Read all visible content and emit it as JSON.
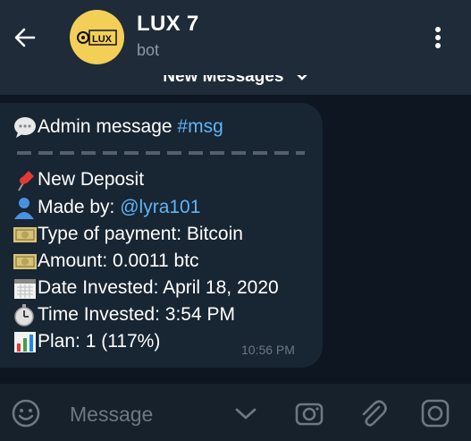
{
  "header": {
    "title": "LUX 7",
    "subtitle": "bot",
    "avatar_text": "LUX",
    "avatar_color": "#f3cf58"
  },
  "new_messages_label": "New Messages",
  "message": {
    "title_text": "Admin message ",
    "hashtag": "#msg",
    "deposit_label": "New Deposit",
    "made_by_label": "Made by: ",
    "made_by_user": "@lyra101",
    "payment_type": "Type of payment: Bitcoin",
    "amount": "Amount: 0.0011 btc",
    "date_invested": "Date Invested: April 18, 2020",
    "time_invested": "Time Invested: 3:54 PM",
    "plan": "Plan: 1 (117%)",
    "timestamp": "10:56 PM",
    "icons": [
      "speech-balloon",
      "pushpin",
      "bust",
      "banknote",
      "banknote",
      "calendar",
      "stopwatch",
      "bar-chart"
    ]
  },
  "composer": {
    "placeholder": "Message",
    "icons": [
      "emoji",
      "chevron-down",
      "camera",
      "paperclip",
      "instagram"
    ]
  },
  "colors": {
    "link": "#5eb5f7",
    "bubble": "#182533",
    "header": "#1f2b38",
    "background": "#0e1621"
  }
}
